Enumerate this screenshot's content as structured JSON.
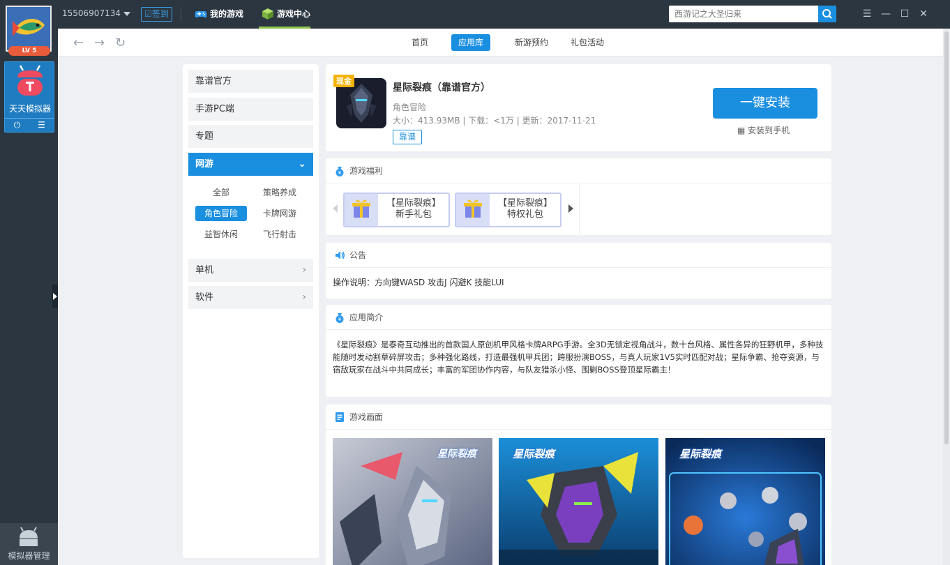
{
  "titlebar": {
    "user_id": "15506907134",
    "signin_label": "签到",
    "nav_mygames": "我的游戏",
    "nav_center": "游戏中心",
    "search_placeholder": "西游记之大圣归来"
  },
  "leftbar": {
    "level": "LV 5",
    "emulator_label": "天天模拟器",
    "manager_label": "模拟器管理"
  },
  "navbar": {
    "tabs": [
      "首页",
      "应用库",
      "新游预约",
      "礼包活动"
    ],
    "active_tab": "应用库"
  },
  "categories": {
    "items": [
      "靠谱官方",
      "手游PC端",
      "专题",
      "网游",
      "单机",
      "软件"
    ],
    "active": "网游",
    "subcategories": [
      "全部",
      "策略养成",
      "角色冒险",
      "卡牌网游",
      "益智休闲",
      "飞行射击"
    ],
    "active_sub": "角色冒险"
  },
  "app": {
    "badge": "现金",
    "title": "星际裂痕（靠谱官方）",
    "category": "角色冒险",
    "meta": "大小：413.93MB | 下载：<1万 | 更新：2017-11-21",
    "tag": "靠谱",
    "install_label": "一键安装",
    "to_phone_label": "安装到手机"
  },
  "welfare": {
    "title": "游戏福利",
    "gifts": [
      {
        "line1": "【星际裂痕】",
        "line2": "新手礼包"
      },
      {
        "line1": "【星际裂痕】",
        "line2": "特权礼包"
      }
    ]
  },
  "notice": {
    "title": "公告",
    "text": "操作说明：方向键WASD 攻击J 闪避K 技能LUI"
  },
  "intro": {
    "title": "应用简介",
    "text": "《星际裂痕》是泰奇互动推出的首款国人原创机甲风格卡牌ARPG手游。全3D无锁定视角战斗，数十台风格、属性各异的狂野机甲，多种技能随时发动割草碎屏攻击；多种强化路线，打造最强机甲兵团；跨服扮演BOSS，与真人玩家1V5实时匹配对战；星际争霸、抢夺资源，与宿敌玩家在战斗中共同成长；丰富的军团协作内容，与队友猎杀小怪、围剿BOSS登顶星际霸主！"
  },
  "screens": {
    "title": "游戏画面",
    "logo_text": "星际裂痕"
  },
  "colors": {
    "accent": "#1a8fe0",
    "sidebar_bg": "#2b3640",
    "content_bg": "#eef0f3",
    "cash_badge": "#f3b300"
  }
}
